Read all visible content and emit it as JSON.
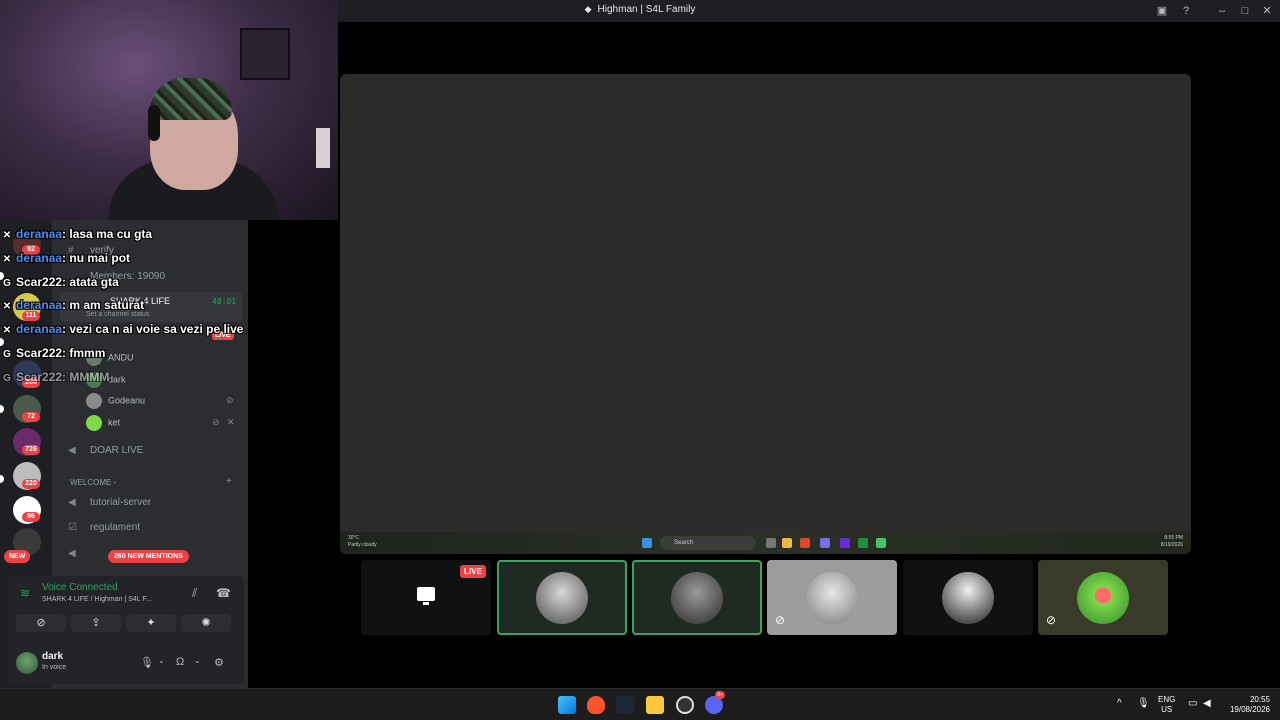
{
  "window": {
    "title": "Highman | S4L Family",
    "logo_icon": "shark-icon"
  },
  "webcam": {
    "subject": "streamer-webcam"
  },
  "chat": [
    {
      "badge": "sword-icon",
      "user": "deranaa",
      "message": "lasa ma cu gta",
      "color": "blue"
    },
    {
      "badge": "sword-icon",
      "user": "deranaa",
      "message": "nu mai pot",
      "color": "blue"
    },
    {
      "badge": "gg-icon",
      "user": "Scar222",
      "message": "atata gta",
      "color": "white"
    },
    {
      "badge": "sword-icon",
      "user": "deranaa",
      "message": "m am saturat",
      "color": "blue"
    },
    {
      "badge": "sword-icon",
      "user": "deranaa",
      "message": "vezi ca n ai voie sa vezi pe live",
      "color": "blue"
    },
    {
      "badge": "gg-icon",
      "user": "Scar222",
      "message": "fmmm",
      "color": "white"
    },
    {
      "badge": "gg-icon",
      "user": "Scar222",
      "message": "MMMM",
      "color": "white"
    }
  ],
  "servers": {
    "badges": [
      "92",
      "111",
      "260",
      "72",
      "726",
      "220",
      "86"
    ],
    "new_label": "NEW"
  },
  "channels": {
    "verify": "verify",
    "members": "Members: 19090",
    "voice_channel": "SHARK 4 LIFE",
    "voice_timer": "48:01",
    "channel_status_hint": "Set a channel status",
    "live_label": "LIVE",
    "members_list": [
      {
        "name": "ANDU",
        "muted": false
      },
      {
        "name": "dark",
        "muted": false
      },
      {
        "name": "Godeanu",
        "muted": true
      },
      {
        "name": "ket",
        "muted": true
      }
    ],
    "doar_live": "DOAR LIVE",
    "welcome_category": "WELCOME -",
    "tutorial": "tutorial-server",
    "regulament": "regulament",
    "new_mentions": "260 NEW MENTIONS"
  },
  "voice_panel": {
    "status": "Voice Connected",
    "channel": "SHARK 4 LIFE / Highman | S4L F...",
    "user_name": "dark",
    "user_status": "In voice"
  },
  "stream": {
    "live_badge": "LIVE",
    "inner_taskbar": {
      "temperature": "30°C",
      "weather": "Partly cloudy",
      "search": "Search",
      "time": "8:55 PM",
      "date": "8/19/2026"
    }
  },
  "tiles": [
    {
      "id": "screen",
      "speaking": false,
      "muted": false,
      "color": "#111111"
    },
    {
      "id": "user-1",
      "speaking": true,
      "muted": false,
      "color": "#b9b9b9"
    },
    {
      "id": "user-2",
      "speaking": true,
      "muted": false,
      "color": "#7c7c7c"
    },
    {
      "id": "user-3",
      "speaking": false,
      "muted": true,
      "color": "#9a9a9a"
    },
    {
      "id": "user-4",
      "speaking": false,
      "muted": false,
      "color": "#e8e8e8"
    },
    {
      "id": "user-5",
      "speaking": false,
      "muted": true,
      "color": "#55c13b"
    }
  ],
  "taskbar": {
    "lang_1": "ENG",
    "lang_2": "US",
    "time": "20:55",
    "date": "19/08/2026",
    "discord_badge": "9+"
  }
}
